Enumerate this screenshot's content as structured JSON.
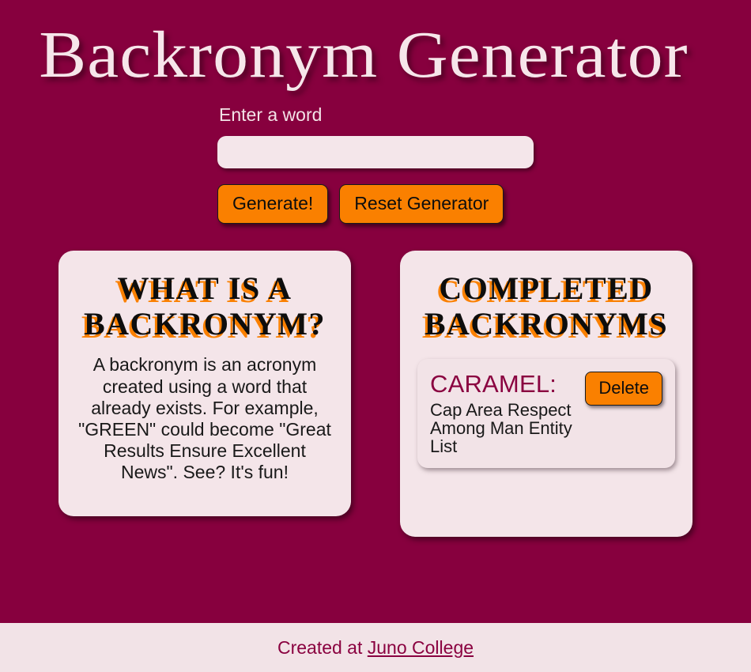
{
  "header": {
    "title": "Backronym Generator"
  },
  "form": {
    "label": "Enter a word",
    "input_value": "",
    "input_placeholder": "",
    "generate_label": "Generate!",
    "reset_label": "Reset Generator"
  },
  "info_card": {
    "heading": "What is a backronym?",
    "body": "A backronym is an acronym created using a word that already exists. For example, \"GREEN\" could become \"Great Results Ensure Excellent News\". See? It's fun!"
  },
  "list_card": {
    "heading": "Completed Backronyms",
    "items": [
      {
        "word": "CARAMEL:",
        "expansion": "Cap Area Respect Among Man Entity List",
        "delete_label": "Delete"
      }
    ]
  },
  "footer": {
    "prefix": "Created at ",
    "link_label": "Juno College"
  },
  "colors": {
    "background": "#87003E",
    "card": "#F4E5E9",
    "accent_orange": "#FA8000",
    "brand_magenta": "#8A0240",
    "text_light": "#F3E3E7"
  }
}
